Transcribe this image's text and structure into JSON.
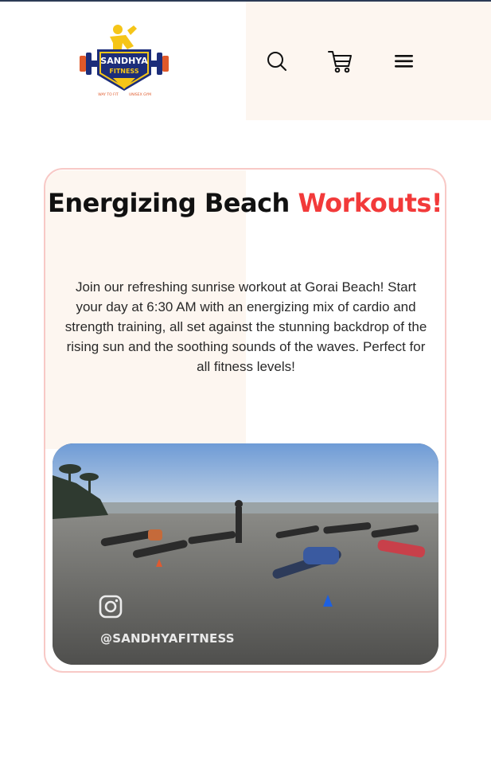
{
  "header": {
    "logo": {
      "name": "SANDHYA",
      "sub": "FITNESS",
      "tagline_left": "WAY TO FIT",
      "tagline_right": "UNISEX GYM"
    },
    "icons": [
      "search-icon",
      "cart-icon",
      "hamburger-menu-icon"
    ]
  },
  "card": {
    "title_main": "Energizing Beach ",
    "title_accent": "Workouts!",
    "description": "Join our refreshing sunrise workout at Gorai Beach! Start your day at 6:30 AM with an energizing mix of cardio and strength training, all set against the stunning backdrop of the rising sun and the soothing sounds of the waves. Perfect for all fitness levels!",
    "media": {
      "overlay_icon": "instagram-icon",
      "handle": "@SANDHYAFITNESS"
    }
  },
  "colors": {
    "accent": "#f23a3a",
    "cream": "#fdf6f0",
    "card_border": "#f8c9c6",
    "logo_navy": "#1c2d7a",
    "logo_gold": "#f5c518"
  }
}
